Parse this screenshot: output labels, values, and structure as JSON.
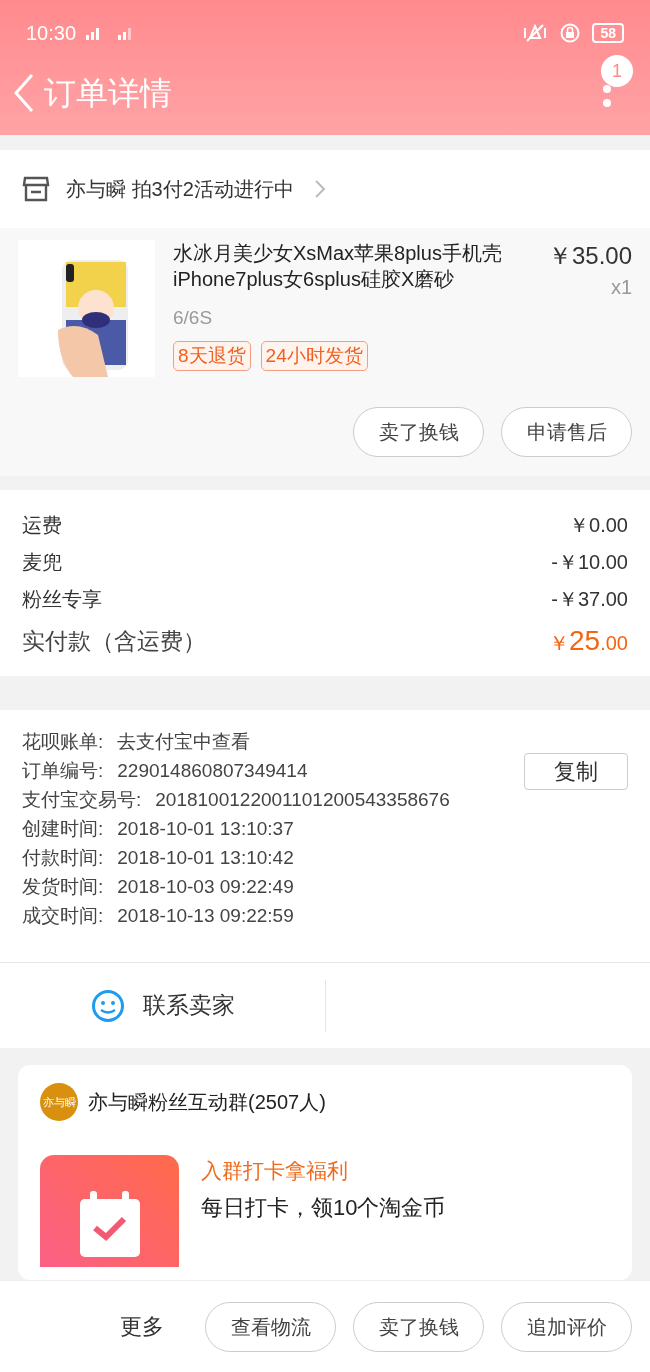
{
  "status_bar": {
    "time": "10:30",
    "battery": "58"
  },
  "header": {
    "title": "订单详情",
    "badge": "1"
  },
  "shop": {
    "text": "亦与瞬 拍3付2活动进行中"
  },
  "product": {
    "title": "水冰月美少女XsMax苹果8plus手机壳iPhone7plus女6splus硅胶X磨砂",
    "price": "￥35.00",
    "quantity": "x1",
    "variant": "6/6S",
    "tags": [
      "8天退货",
      "24小时发货"
    ],
    "buttons": [
      "卖了换钱",
      "申请售后"
    ]
  },
  "fees": [
    {
      "label": "运费",
      "value": "￥0.00"
    },
    {
      "label": "麦兜",
      "value": "-￥10.00"
    },
    {
      "label": "粉丝专享",
      "value": "-￥37.00"
    }
  ],
  "total": {
    "label": "实付款（含运费）",
    "currency": "￥",
    "integer": "25",
    "decimals": ".00"
  },
  "info": [
    {
      "label": "花呗账单:",
      "value": "去支付宝中查看"
    },
    {
      "label": "订单编号:",
      "value": "229014860807349414",
      "action": "复制"
    },
    {
      "label": "支付宝交易号:",
      "value": "2018100122001101200543358676"
    },
    {
      "label": "创建时间:",
      "value": "2018-10-01 13:10:37"
    },
    {
      "label": "付款时间:",
      "value": "2018-10-01 13:10:42"
    },
    {
      "label": "发货时间:",
      "value": "2018-10-03 09:22:49"
    },
    {
      "label": "成交时间:",
      "value": "2018-10-13 09:22:59"
    }
  ],
  "contact": {
    "label": "联系卖家"
  },
  "group_card": {
    "avatar": "亦与瞬",
    "name": "亦与瞬粉丝互动群(2507人)",
    "promo_title": "入群打卡拿福利",
    "promo_text": "每日打卡，领10个淘金币"
  },
  "bottom_bar": {
    "more": "更多",
    "buttons": [
      "查看物流",
      "卖了换钱",
      "追加评价"
    ]
  }
}
